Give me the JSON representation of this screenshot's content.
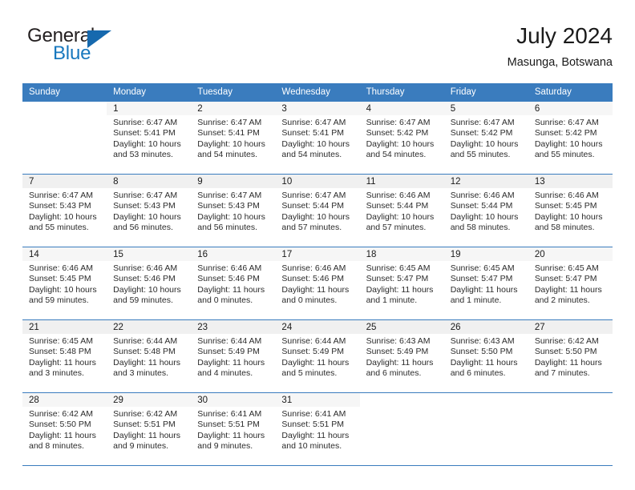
{
  "brand": {
    "line1": "General",
    "line2": "Blue",
    "accent_color": "#1669ae",
    "text_color": "#231f20"
  },
  "header": {
    "title": "July 2024",
    "location": "Masunga, Botswana"
  },
  "calendar": {
    "header_bg": "#3a7cbe",
    "weekdays": [
      "Sunday",
      "Monday",
      "Tuesday",
      "Wednesday",
      "Thursday",
      "Friday",
      "Saturday"
    ],
    "weeks": [
      [
        {
          "day": ""
        },
        {
          "day": "1",
          "sunrise": "Sunrise: 6:47 AM",
          "sunset": "Sunset: 5:41 PM",
          "daylight": "Daylight: 10 hours and 53 minutes."
        },
        {
          "day": "2",
          "sunrise": "Sunrise: 6:47 AM",
          "sunset": "Sunset: 5:41 PM",
          "daylight": "Daylight: 10 hours and 54 minutes."
        },
        {
          "day": "3",
          "sunrise": "Sunrise: 6:47 AM",
          "sunset": "Sunset: 5:41 PM",
          "daylight": "Daylight: 10 hours and 54 minutes."
        },
        {
          "day": "4",
          "sunrise": "Sunrise: 6:47 AM",
          "sunset": "Sunset: 5:42 PM",
          "daylight": "Daylight: 10 hours and 54 minutes."
        },
        {
          "day": "5",
          "sunrise": "Sunrise: 6:47 AM",
          "sunset": "Sunset: 5:42 PM",
          "daylight": "Daylight: 10 hours and 55 minutes."
        },
        {
          "day": "6",
          "sunrise": "Sunrise: 6:47 AM",
          "sunset": "Sunset: 5:42 PM",
          "daylight": "Daylight: 10 hours and 55 minutes."
        }
      ],
      [
        {
          "day": "7",
          "sunrise": "Sunrise: 6:47 AM",
          "sunset": "Sunset: 5:43 PM",
          "daylight": "Daylight: 10 hours and 55 minutes."
        },
        {
          "day": "8",
          "sunrise": "Sunrise: 6:47 AM",
          "sunset": "Sunset: 5:43 PM",
          "daylight": "Daylight: 10 hours and 56 minutes."
        },
        {
          "day": "9",
          "sunrise": "Sunrise: 6:47 AM",
          "sunset": "Sunset: 5:43 PM",
          "daylight": "Daylight: 10 hours and 56 minutes."
        },
        {
          "day": "10",
          "sunrise": "Sunrise: 6:47 AM",
          "sunset": "Sunset: 5:44 PM",
          "daylight": "Daylight: 10 hours and 57 minutes."
        },
        {
          "day": "11",
          "sunrise": "Sunrise: 6:46 AM",
          "sunset": "Sunset: 5:44 PM",
          "daylight": "Daylight: 10 hours and 57 minutes."
        },
        {
          "day": "12",
          "sunrise": "Sunrise: 6:46 AM",
          "sunset": "Sunset: 5:44 PM",
          "daylight": "Daylight: 10 hours and 58 minutes."
        },
        {
          "day": "13",
          "sunrise": "Sunrise: 6:46 AM",
          "sunset": "Sunset: 5:45 PM",
          "daylight": "Daylight: 10 hours and 58 minutes."
        }
      ],
      [
        {
          "day": "14",
          "sunrise": "Sunrise: 6:46 AM",
          "sunset": "Sunset: 5:45 PM",
          "daylight": "Daylight: 10 hours and 59 minutes."
        },
        {
          "day": "15",
          "sunrise": "Sunrise: 6:46 AM",
          "sunset": "Sunset: 5:46 PM",
          "daylight": "Daylight: 10 hours and 59 minutes."
        },
        {
          "day": "16",
          "sunrise": "Sunrise: 6:46 AM",
          "sunset": "Sunset: 5:46 PM",
          "daylight": "Daylight: 11 hours and 0 minutes."
        },
        {
          "day": "17",
          "sunrise": "Sunrise: 6:46 AM",
          "sunset": "Sunset: 5:46 PM",
          "daylight": "Daylight: 11 hours and 0 minutes."
        },
        {
          "day": "18",
          "sunrise": "Sunrise: 6:45 AM",
          "sunset": "Sunset: 5:47 PM",
          "daylight": "Daylight: 11 hours and 1 minute."
        },
        {
          "day": "19",
          "sunrise": "Sunrise: 6:45 AM",
          "sunset": "Sunset: 5:47 PM",
          "daylight": "Daylight: 11 hours and 1 minute."
        },
        {
          "day": "20",
          "sunrise": "Sunrise: 6:45 AM",
          "sunset": "Sunset: 5:47 PM",
          "daylight": "Daylight: 11 hours and 2 minutes."
        }
      ],
      [
        {
          "day": "21",
          "sunrise": "Sunrise: 6:45 AM",
          "sunset": "Sunset: 5:48 PM",
          "daylight": "Daylight: 11 hours and 3 minutes."
        },
        {
          "day": "22",
          "sunrise": "Sunrise: 6:44 AM",
          "sunset": "Sunset: 5:48 PM",
          "daylight": "Daylight: 11 hours and 3 minutes."
        },
        {
          "day": "23",
          "sunrise": "Sunrise: 6:44 AM",
          "sunset": "Sunset: 5:49 PM",
          "daylight": "Daylight: 11 hours and 4 minutes."
        },
        {
          "day": "24",
          "sunrise": "Sunrise: 6:44 AM",
          "sunset": "Sunset: 5:49 PM",
          "daylight": "Daylight: 11 hours and 5 minutes."
        },
        {
          "day": "25",
          "sunrise": "Sunrise: 6:43 AM",
          "sunset": "Sunset: 5:49 PM",
          "daylight": "Daylight: 11 hours and 6 minutes."
        },
        {
          "day": "26",
          "sunrise": "Sunrise: 6:43 AM",
          "sunset": "Sunset: 5:50 PM",
          "daylight": "Daylight: 11 hours and 6 minutes."
        },
        {
          "day": "27",
          "sunrise": "Sunrise: 6:42 AM",
          "sunset": "Sunset: 5:50 PM",
          "daylight": "Daylight: 11 hours and 7 minutes."
        }
      ],
      [
        {
          "day": "28",
          "sunrise": "Sunrise: 6:42 AM",
          "sunset": "Sunset: 5:50 PM",
          "daylight": "Daylight: 11 hours and 8 minutes."
        },
        {
          "day": "29",
          "sunrise": "Sunrise: 6:42 AM",
          "sunset": "Sunset: 5:51 PM",
          "daylight": "Daylight: 11 hours and 9 minutes."
        },
        {
          "day": "30",
          "sunrise": "Sunrise: 6:41 AM",
          "sunset": "Sunset: 5:51 PM",
          "daylight": "Daylight: 11 hours and 9 minutes."
        },
        {
          "day": "31",
          "sunrise": "Sunrise: 6:41 AM",
          "sunset": "Sunset: 5:51 PM",
          "daylight": "Daylight: 11 hours and 10 minutes."
        },
        {
          "day": ""
        },
        {
          "day": ""
        },
        {
          "day": ""
        }
      ]
    ]
  }
}
